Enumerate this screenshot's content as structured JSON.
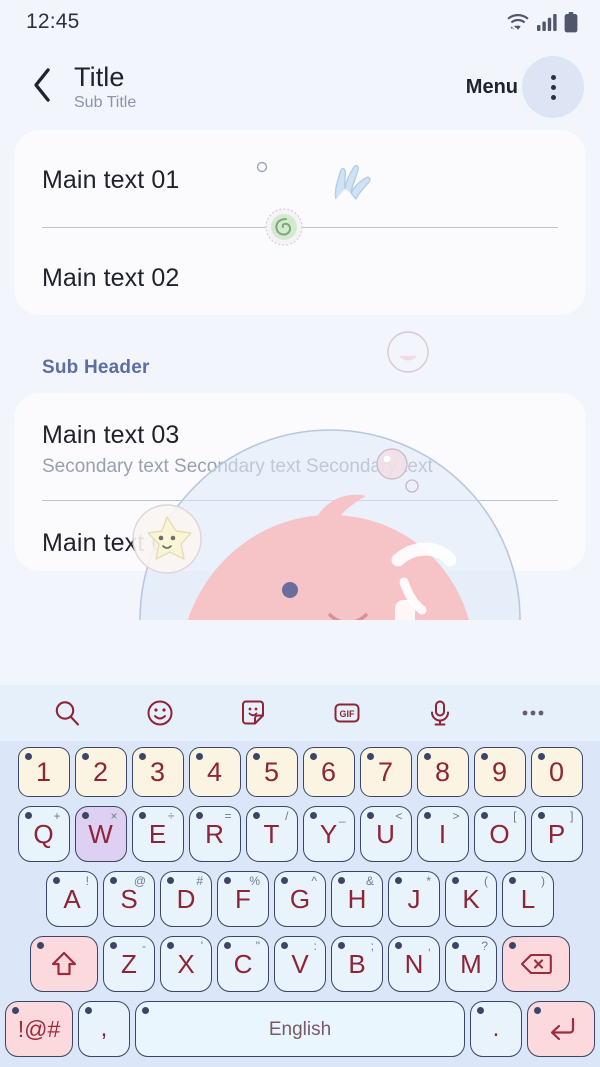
{
  "status_bar": {
    "clock": "12:45",
    "icons": [
      "wifi-icon",
      "signal-icon",
      "battery-icon"
    ]
  },
  "app_bar": {
    "back_icon": "chevron-left-icon",
    "title": "Title",
    "subtitle": "Sub Title",
    "menu_label": "Menu",
    "overflow_icon": "more-vertical-icon"
  },
  "content": {
    "card_one": {
      "rows": [
        {
          "main": "Main text 01"
        },
        {
          "main": "Main text 02"
        }
      ]
    },
    "sub_header": "Sub Header",
    "card_two": {
      "rows": [
        {
          "main": "Main text 03",
          "secondary": "Secondary text Secondary text Secondary text"
        },
        {
          "main": "Main text 04"
        }
      ]
    }
  },
  "keyboard": {
    "toolbar": [
      {
        "name": "search-icon",
        "label": "Search"
      },
      {
        "name": "emoji-icon",
        "label": "Emoji"
      },
      {
        "name": "sticker-icon",
        "label": "Sticker"
      },
      {
        "name": "gif-icon",
        "label": "GIF"
      },
      {
        "name": "microphone-icon",
        "label": "Voice input"
      },
      {
        "name": "more-horizontal-icon",
        "label": "More"
      }
    ],
    "rows": {
      "numbers": [
        {
          "cap": "1"
        },
        {
          "cap": "2"
        },
        {
          "cap": "3"
        },
        {
          "cap": "4"
        },
        {
          "cap": "5"
        },
        {
          "cap": "6"
        },
        {
          "cap": "7"
        },
        {
          "cap": "8"
        },
        {
          "cap": "9"
        },
        {
          "cap": "0"
        }
      ],
      "top": [
        {
          "cap": "Q",
          "sec": "+"
        },
        {
          "cap": "W",
          "sec": "×",
          "pressed": true
        },
        {
          "cap": "E",
          "sec": "÷"
        },
        {
          "cap": "R",
          "sec": "="
        },
        {
          "cap": "T",
          "sec": "/"
        },
        {
          "cap": "Y",
          "sec": "_"
        },
        {
          "cap": "U",
          "sec": "<"
        },
        {
          "cap": "I",
          "sec": ">"
        },
        {
          "cap": "O",
          "sec": "["
        },
        {
          "cap": "P",
          "sec": "]"
        }
      ],
      "home": [
        {
          "cap": "A",
          "sec": "!"
        },
        {
          "cap": "S",
          "sec": "@"
        },
        {
          "cap": "D",
          "sec": "#"
        },
        {
          "cap": "F",
          "sec": "%"
        },
        {
          "cap": "G",
          "sec": "^"
        },
        {
          "cap": "H",
          "sec": "&"
        },
        {
          "cap": "J",
          "sec": "*"
        },
        {
          "cap": "K",
          "sec": "("
        },
        {
          "cap": "L",
          "sec": ")"
        }
      ],
      "bottom": [
        {
          "cap": "Z",
          "sec": "-"
        },
        {
          "cap": "X",
          "sec": "'"
        },
        {
          "cap": "C",
          "sec": "\""
        },
        {
          "cap": "V",
          "sec": ":"
        },
        {
          "cap": "B",
          "sec": ";"
        },
        {
          "cap": "N",
          "sec": ","
        },
        {
          "cap": "M",
          "sec": "?"
        }
      ],
      "shift_icon": "shift-arrow-icon",
      "backspace_icon": "backspace-icon",
      "symbols_key": "!@#",
      "comma_key": ",",
      "space_label": "English",
      "period_key": ".",
      "enter_icon": "enter-arrow-icon"
    }
  },
  "colors": {
    "screen_bg": "#f2f5fc",
    "card_bg": "#fdfcfe",
    "key_letter_bg": "#e9f3fb",
    "key_number_bg": "#fbf4e2",
    "key_pressed_bg": "#ddd0f2",
    "key_accent_bg": "#fbd9dc",
    "key_text": "#8f2436",
    "key_border": "#3b4566",
    "keyboard_bg": "#dbe6f8",
    "toolbar_bg": "#e6f0fb",
    "sub_header_text": "#5d6da6",
    "secondary_text": "#9aa0b0"
  }
}
